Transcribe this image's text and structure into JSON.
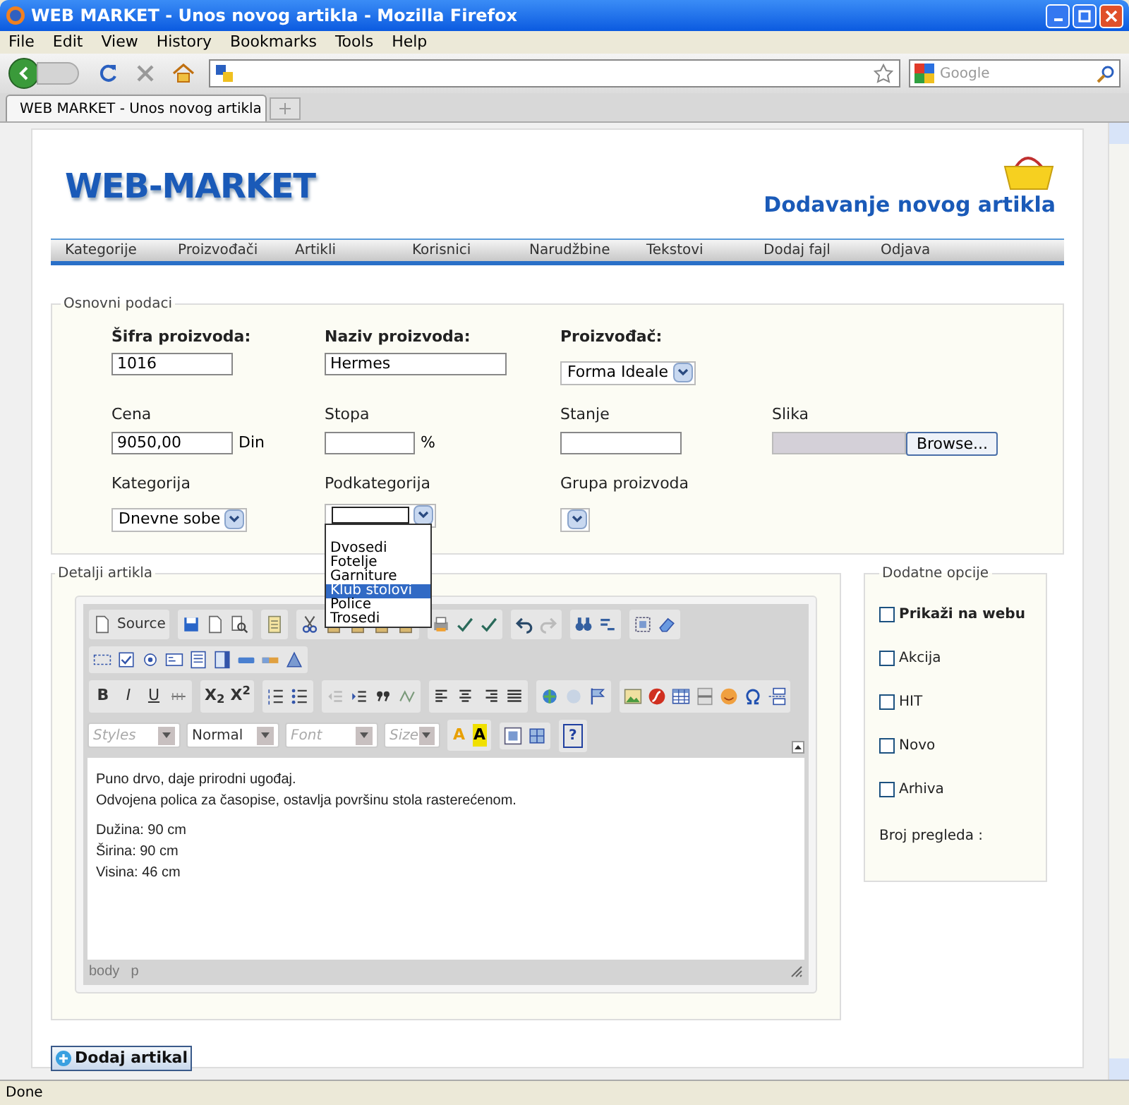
{
  "window": {
    "title": "WEB MARKET - Unos novog artikla - Mozilla Firefox"
  },
  "menu": [
    "File",
    "Edit",
    "View",
    "History",
    "Bookmarks",
    "Tools",
    "Help"
  ],
  "search": {
    "placeholder": "Google"
  },
  "tabs": [
    {
      "label": "WEB MARKET - Unos novog artikla",
      "selected": true
    }
  ],
  "page": {
    "logo": "WEB-MARKET",
    "heading": "Dodavanje novog artikla",
    "nav": [
      "Kategorije",
      "Proizvođači",
      "Artikli",
      "Korisnici",
      "Narudžbine",
      "Tekstovi",
      "Dodaj fajl",
      "Odjava"
    ]
  },
  "basic": {
    "legend": "Osnovni podaci",
    "rows": [
      [
        {
          "kind": "text",
          "label": "Šifra proizvoda:",
          "bold": true,
          "value": "1016"
        },
        {
          "kind": "text",
          "label": "Naziv proizvoda:",
          "bold": true,
          "value": "Hermes"
        },
        {
          "kind": "select",
          "label": "Proizvođač:",
          "bold": true,
          "value": "Forma Ideale"
        }
      ],
      [
        {
          "kind": "text",
          "label": "Cena",
          "bold": false,
          "value": "9050,00",
          "unit": "Din"
        },
        {
          "kind": "text",
          "label": "Stopa",
          "bold": false,
          "unit": "%"
        },
        {
          "kind": "text",
          "label": "Stanje",
          "bold": false
        },
        {
          "kind": "file",
          "label": "Slika",
          "bold": false,
          "button": "Browse..."
        }
      ],
      [
        {
          "kind": "select",
          "label": "Kategorija",
          "bold": false,
          "value": "Dnevne sobe"
        },
        {
          "kind": "select",
          "label": "Podkategorija",
          "bold": false,
          "expanded": true,
          "options": [
            {
              "label": "Dvosedi",
              "selected": false
            },
            {
              "label": "Fotelje",
              "selected": false
            },
            {
              "label": "Garniture",
              "selected": false
            },
            {
              "label": "Klub stolovi",
              "selected": true
            },
            {
              "label": "Police",
              "selected": false
            },
            {
              "label": "Trosedi",
              "selected": false
            }
          ]
        },
        {
          "kind": "select",
          "label": "Grupa proizvoda",
          "bold": false
        }
      ]
    ]
  },
  "details": {
    "legend": "Detalji artikla",
    "editor": {
      "source": "Source",
      "format": [
        {
          "kind": "bold",
          "label": "B"
        },
        {
          "kind": "italic",
          "label": "I"
        },
        {
          "kind": "underline",
          "label": "U"
        }
      ],
      "scripts": [
        "X$_{2}$",
        "X$^{2}$"
      ],
      "combos": [
        {
          "placeholder": "Styles"
        },
        {
          "value": "Normal"
        },
        {
          "placeholder": "Font"
        },
        {
          "placeholder": "Size"
        }
      ],
      "colors": [
        {
          "label": "A",
          "color": "#e8a000"
        },
        {
          "label": "A",
          "color": "#f0e000"
        }
      ],
      "help": "?",
      "paragraphs": [
        [
          "Puno drvo, daje prirodni ugođaj.",
          "Odvojena polica za časopise, ostavlja površinu stola rasterećenom."
        ],
        [
          "Dužina: 90 cm",
          "Širina: 90 cm",
          "Visina: 46 cm"
        ]
      ],
      "path": [
        "body",
        "p"
      ]
    }
  },
  "options": {
    "legend": "Dodatne opcije",
    "checks": [
      {
        "label": "Prikaži na webu",
        "bold": true,
        "checked": false
      },
      {
        "label": "Akcija",
        "bold": false,
        "checked": false
      },
      {
        "label": "HIT",
        "bold": false,
        "checked": false
      },
      {
        "label": "Novo",
        "bold": false,
        "checked": false
      },
      {
        "label": "Arhiva",
        "bold": false,
        "checked": false
      }
    ],
    "views": "Broj pregleda :"
  },
  "submit": "Dodaj artikal",
  "status_bar": "Done"
}
